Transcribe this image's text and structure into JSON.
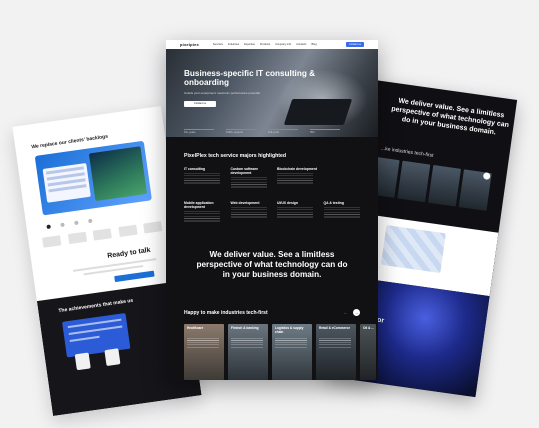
{
  "left_page": {
    "title": "We replace our clients' backlogs",
    "ready_text": "Ready to talk",
    "achievements_title": "The achievements that make us",
    "card_text": "PixelPlex was ranked Top-10"
  },
  "center_page": {
    "nav": {
      "logo": "pixelplex",
      "menu": [
        "Services",
        "Industries",
        "Expertise",
        "Products",
        "Company info",
        "Contacts",
        "Blog"
      ],
      "contact_label": "Contact us"
    },
    "hero": {
      "title": "Business-specific IT consulting & onboarding",
      "subtitle": "Unlock your enterprise's maximum performance potential",
      "button_label": "Contact us",
      "stats": [
        "15+ years",
        "1000+ projects",
        "Full-cycle",
        "ISO"
      ]
    },
    "services_title": "PixelPlex tech service majors highlighted",
    "services": [
      "IT consulting",
      "Custom software development",
      "Blockchain development",
      "",
      "Mobile application development",
      "Web development",
      "UI/UX design",
      "QA & testing"
    ],
    "value_text": "We deliver value. See a limitless perspective of what technology can do in your business domain.",
    "industries_title": "Happy to make industries tech-first",
    "arrow_prev": "←",
    "arrow_next": "→",
    "industries": [
      "Healthcare",
      "Fintech & banking",
      "Logistics & supply chain",
      "Retail & eCommerce",
      "Oil & ..."
    ]
  },
  "right_page": {
    "heading": "We deliver value. See a limitless perspective of what technology can do in your business domain.",
    "sub": "...ke industries tech-first",
    "form_text": "...tform for"
  },
  "colors": {
    "accent": "#3a6ae8",
    "dark_bg": "#111113",
    "page_bg": "#f2f2f3"
  }
}
